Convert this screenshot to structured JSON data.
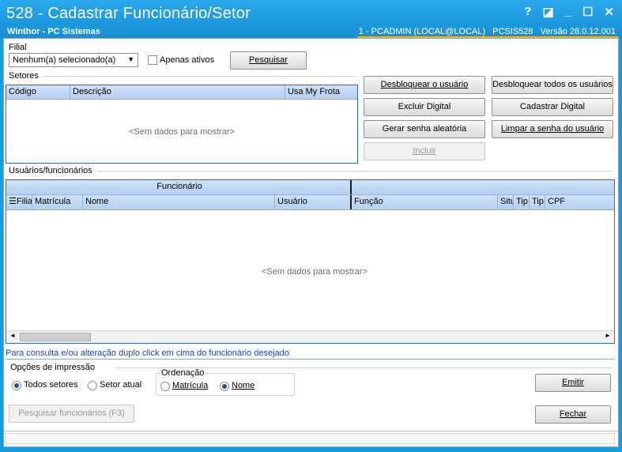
{
  "window": {
    "title": "528 - Cadastrar Funcionário/Setor",
    "subtitle": "Winthor - PC Sistemas",
    "status_user": "1 - PCADMIN (LOCAL@LOCAL)",
    "status_routine": "PCSIS528",
    "status_version": "Versão  28.0.12.001",
    "controls": {
      "help": "?",
      "restore": "◪",
      "minimize": "_",
      "maximize": "☐",
      "close": "✕"
    }
  },
  "filial": {
    "label": "Filial",
    "selected": "Nenhum(a) selecionado(a)",
    "apenas_ativos": "Apenas ativos",
    "pesquisar": "Pesquisar"
  },
  "setores": {
    "label": "Setores",
    "columns": [
      "Código",
      "Descrição",
      "Usa My Frota"
    ],
    "empty": "<Sem dados para mostrar>"
  },
  "actions": {
    "desbloquear_usuario": "Desbloquear o usuário",
    "desbloquear_todos": "Desbloquear todos os usuários",
    "excluir_digital": "Excluir Digital",
    "cadastrar_digital": "Cadastrar Digital",
    "gerar_senha": "Gerar senha aleatória",
    "limpar_senha": "Limpar a senha do usuário",
    "incluir": "Incluir"
  },
  "usuarios": {
    "label": "Usuários/funcionários",
    "band_funcionario": "Funcionário",
    "columns": [
      "Filia",
      "Matrícula",
      "Nome",
      "Usuário",
      "Função",
      "Situ",
      "Tip",
      "Tip",
      "CPF"
    ],
    "empty": "<Sem dados para mostrar>"
  },
  "hint": "Para consulta e/ou alteração duplo click em cima do funcionário desejado",
  "impressao": {
    "label": "Opções de impressão",
    "todos_setores": "Todos setores",
    "setor_atual": "Setor atual",
    "selected": "Todos setores"
  },
  "ordenacao": {
    "label": "Ordenação",
    "matricula": "Matrícula",
    "nome": "Nome",
    "selected": "Nome"
  },
  "footer": {
    "emitir": "Emitir",
    "pesquisar_funcionarios": "Pesquisar funcionários (F3)",
    "fechar": "Fechar"
  },
  "colors": {
    "titlebar": "#1a9be0",
    "grid_border": "#2e6ab3",
    "hint": "#1a3fd0",
    "accent_line": "#ffb400"
  }
}
